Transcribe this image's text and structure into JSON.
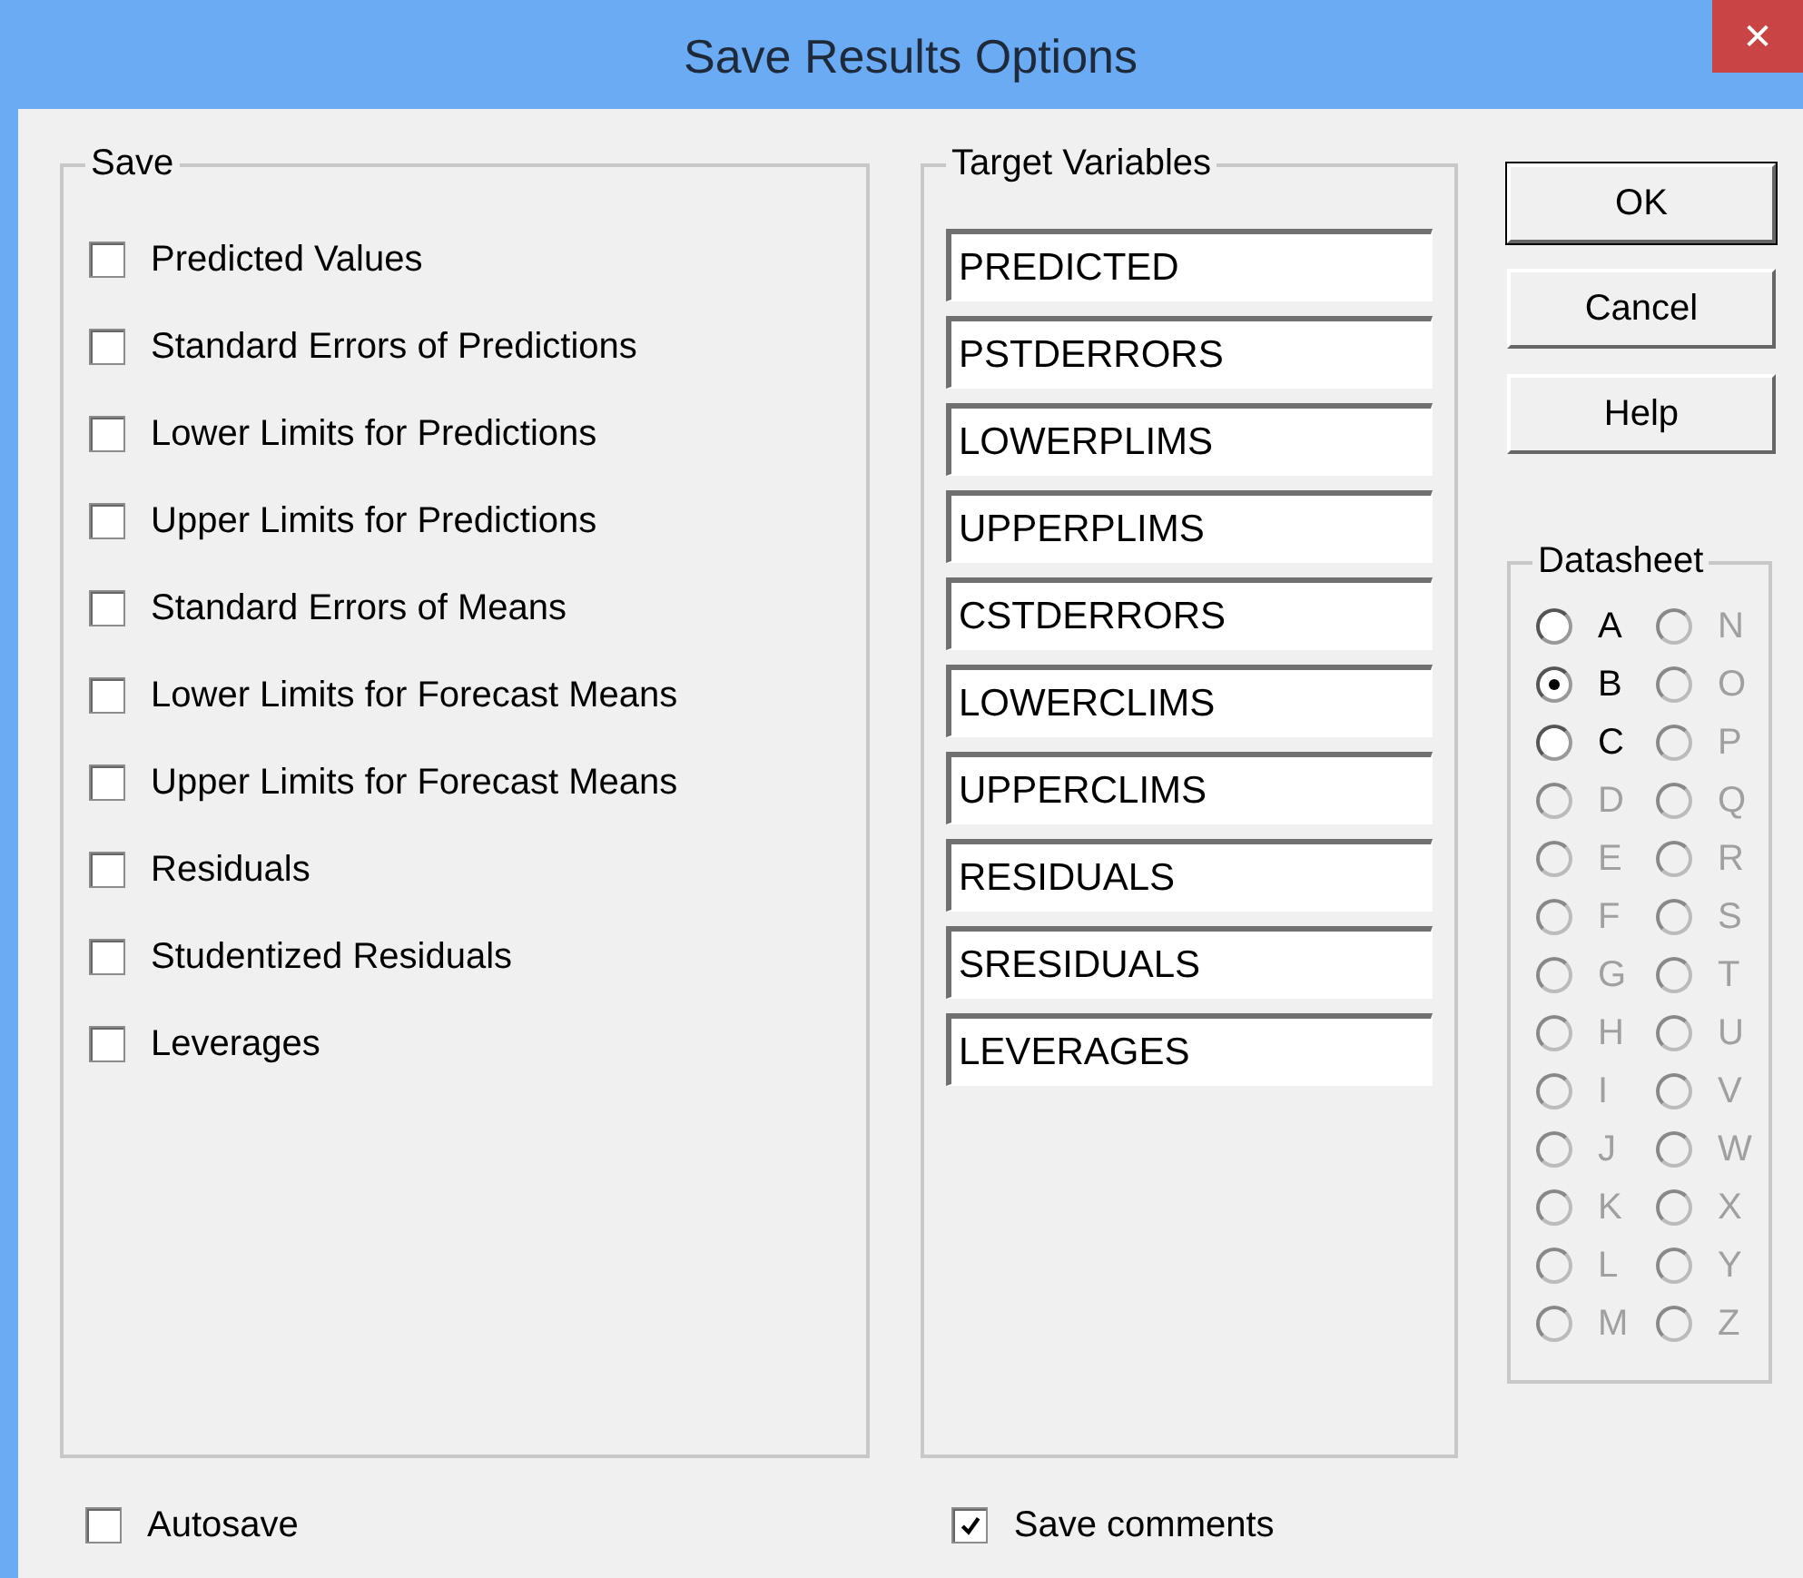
{
  "window": {
    "title": "Save Results Options",
    "close": "✕"
  },
  "save": {
    "title": "Save",
    "items": [
      {
        "label": "Predicted Values",
        "checked": false
      },
      {
        "label": "Standard Errors of Predictions",
        "checked": false
      },
      {
        "label": "Lower Limits for Predictions",
        "checked": false
      },
      {
        "label": "Upper Limits for Predictions",
        "checked": false
      },
      {
        "label": "Standard Errors of Means",
        "checked": false
      },
      {
        "label": "Lower Limits for Forecast Means",
        "checked": false
      },
      {
        "label": "Upper Limits for Forecast Means",
        "checked": false
      },
      {
        "label": "Residuals",
        "checked": false
      },
      {
        "label": "Studentized Residuals",
        "checked": false
      },
      {
        "label": "Leverages",
        "checked": false
      }
    ]
  },
  "target_variables": {
    "title": "Target Variables",
    "fields": [
      "PREDICTED",
      "PSTDERRORS",
      "LOWERPLIMS",
      "UPPERPLIMS",
      "CSTDERRORS",
      "LOWERCLIMS",
      "UPPERCLIMS",
      "RESIDUALS",
      "SRESIDUALS",
      "LEVERAGES"
    ]
  },
  "buttons": [
    "OK",
    "Cancel",
    "Help"
  ],
  "datasheet": {
    "title": "Datasheet",
    "options": [
      {
        "label": "A",
        "selected": false,
        "disabled": false
      },
      {
        "label": "B",
        "selected": true,
        "disabled": false
      },
      {
        "label": "C",
        "selected": false,
        "disabled": false
      },
      {
        "label": "D",
        "selected": false,
        "disabled": true
      },
      {
        "label": "E",
        "selected": false,
        "disabled": true
      },
      {
        "label": "F",
        "selected": false,
        "disabled": true
      },
      {
        "label": "G",
        "selected": false,
        "disabled": true
      },
      {
        "label": "H",
        "selected": false,
        "disabled": true
      },
      {
        "label": "I",
        "selected": false,
        "disabled": true
      },
      {
        "label": "J",
        "selected": false,
        "disabled": true
      },
      {
        "label": "K",
        "selected": false,
        "disabled": true
      },
      {
        "label": "L",
        "selected": false,
        "disabled": true
      },
      {
        "label": "M",
        "selected": false,
        "disabled": true
      },
      {
        "label": "N",
        "selected": false,
        "disabled": true
      },
      {
        "label": "O",
        "selected": false,
        "disabled": true
      },
      {
        "label": "P",
        "selected": false,
        "disabled": true
      },
      {
        "label": "Q",
        "selected": false,
        "disabled": true
      },
      {
        "label": "R",
        "selected": false,
        "disabled": true
      },
      {
        "label": "S",
        "selected": false,
        "disabled": true
      },
      {
        "label": "T",
        "selected": false,
        "disabled": true
      },
      {
        "label": "U",
        "selected": false,
        "disabled": true
      },
      {
        "label": "V",
        "selected": false,
        "disabled": true
      },
      {
        "label": "W",
        "selected": false,
        "disabled": true
      },
      {
        "label": "X",
        "selected": false,
        "disabled": true
      },
      {
        "label": "Y",
        "selected": false,
        "disabled": true
      },
      {
        "label": "Z",
        "selected": false,
        "disabled": true
      }
    ]
  },
  "autosave": {
    "label": "Autosave",
    "checked": false
  },
  "save_comments": {
    "label": "Save comments",
    "checked": true
  }
}
